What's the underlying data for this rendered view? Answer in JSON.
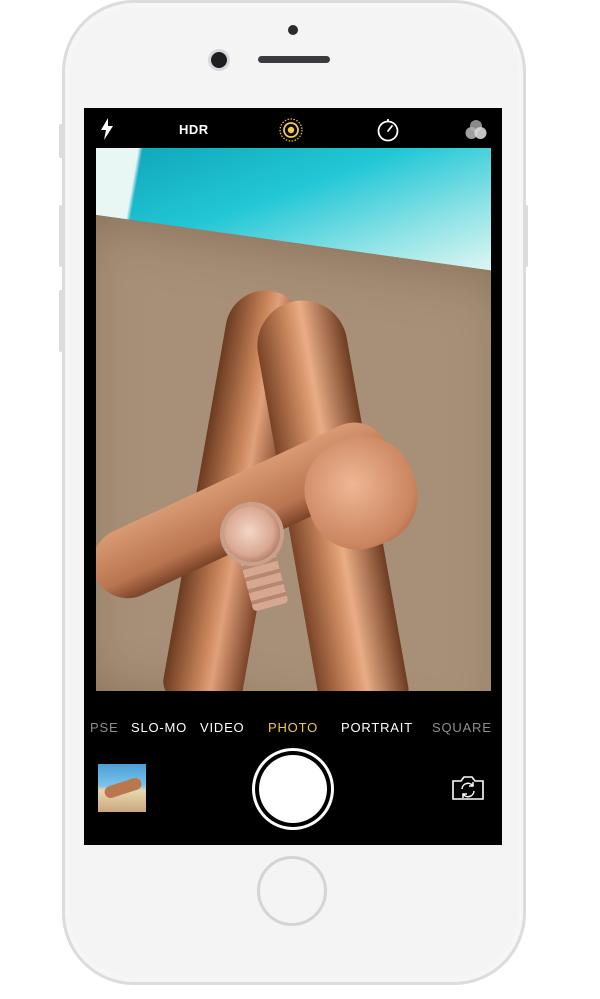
{
  "topbar": {
    "flash_icon": "flash-bolt-icon",
    "hdr_label": "HDR",
    "live_photo_icon": "live-photo-icon",
    "timer_icon": "timer-icon",
    "filters_icon": "filters-icon"
  },
  "modes": {
    "items": [
      {
        "label": "PSE",
        "state": "partial"
      },
      {
        "label": "SLO-MO",
        "state": "normal"
      },
      {
        "label": "VIDEO",
        "state": "normal"
      },
      {
        "label": "PHOTO",
        "state": "selected"
      },
      {
        "label": "PORTRAIT",
        "state": "normal"
      },
      {
        "label": "SQUARE",
        "state": "partial"
      }
    ]
  },
  "controls": {
    "thumbnail_icon": "last-photo-thumbnail",
    "shutter_icon": "shutter-button",
    "flip_icon": "switch-camera-icon"
  },
  "colors": {
    "active_mode": "#f2c94c",
    "screen_bg": "#000000",
    "phone_body": "#ececee"
  }
}
